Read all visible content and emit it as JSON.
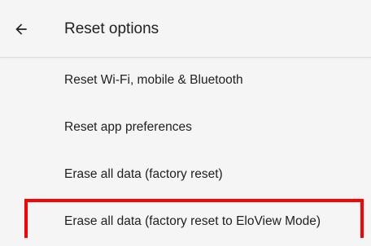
{
  "header": {
    "title": "Reset options",
    "back_icon": "arrow-back-icon"
  },
  "options": [
    {
      "label": "Reset Wi-Fi, mobile & Bluetooth"
    },
    {
      "label": "Reset app preferences"
    },
    {
      "label": "Erase all data (factory reset)"
    },
    {
      "label": "Erase all data (factory reset to EloView Mode)",
      "highlighted": true,
      "highlight_color": "#ff0000"
    }
  ]
}
